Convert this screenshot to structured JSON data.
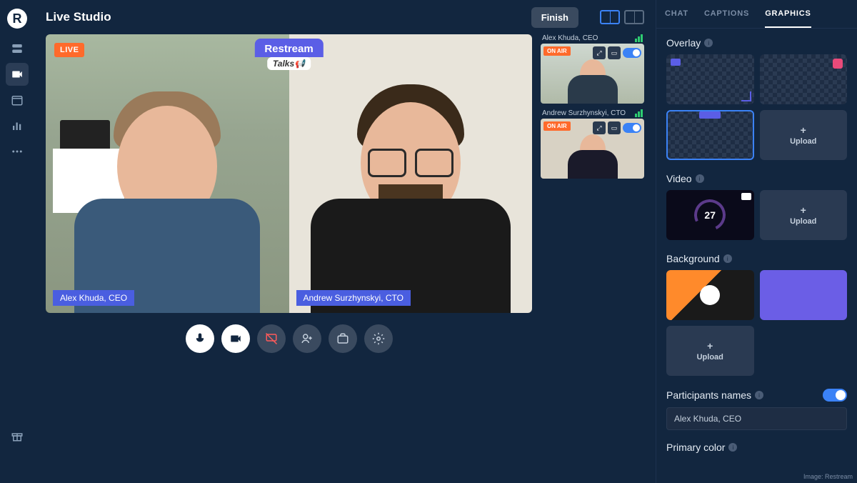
{
  "header": {
    "title": "Live Studio",
    "finish_label": "Finish"
  },
  "stage": {
    "live_label": "LIVE",
    "overlay_main": "Restream",
    "overlay_sub": "Talks📢",
    "feed1_name": "Alex Khuda, CEO",
    "feed2_name": "Andrew Surzhynskyi, CTO"
  },
  "guests": {
    "g1_name": "Alex Khuda, CEO",
    "g2_name": "Andrew Surzhynskyi, CTO",
    "on_air": "ON AIR"
  },
  "tabs": {
    "chat": "CHAT",
    "captions": "CAPTIONS",
    "graphics": "GRAPHICS"
  },
  "panel": {
    "overlay_title": "Overlay",
    "video_title": "Video",
    "video_count": "27",
    "background_title": "Background",
    "upload_label": "Upload",
    "participants_title": "Participants names",
    "participant_value": "Alex Khuda, CEO",
    "primary_color_title": "Primary color"
  },
  "credit": "Image: Restream"
}
